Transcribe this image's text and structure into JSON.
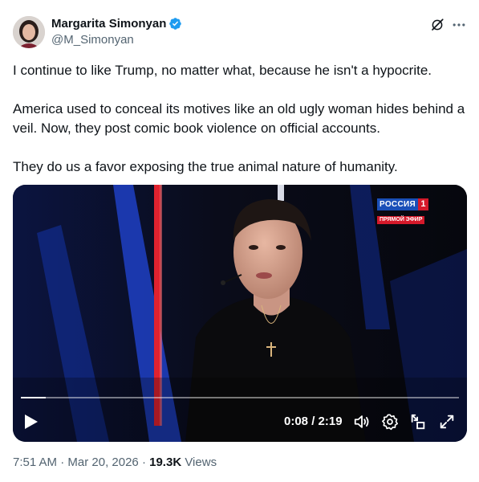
{
  "author": {
    "display_name": "Margarita Simonyan",
    "handle": "@M_Simonyan"
  },
  "header_icons": [
    "grok-icon",
    "more-icon"
  ],
  "tweet": {
    "paragraphs": [
      "I continue to like Trump, no matter what, because he isn't a hypocrite.",
      "America used to conceal its motives like an old ugly woman hides behind a veil. Now, they post comic book violence on official accounts.",
      "They do us a favor exposing the true animal nature of humanity."
    ]
  },
  "video": {
    "channel_name": "РОССИЯ",
    "channel_number": "1",
    "live_label": "ПРЯМОЙ ЭФИР",
    "time_display": "0:08 / 2:19",
    "progress_fraction": 0.057,
    "controls": [
      "play-icon",
      "volume-icon",
      "settings-icon",
      "pip-icon",
      "fullscreen-icon"
    ]
  },
  "meta": {
    "time": "7:51 AM",
    "date": "Mar 20, 2026",
    "views_count": "19.3K",
    "views_label": "Views",
    "sep": "·"
  },
  "colors": {
    "verified": "#1d9bf0",
    "text_primary": "#0f1419",
    "text_secondary": "#536471",
    "channel_blue": "#1a4fb8",
    "channel_red": "#d5192a"
  }
}
